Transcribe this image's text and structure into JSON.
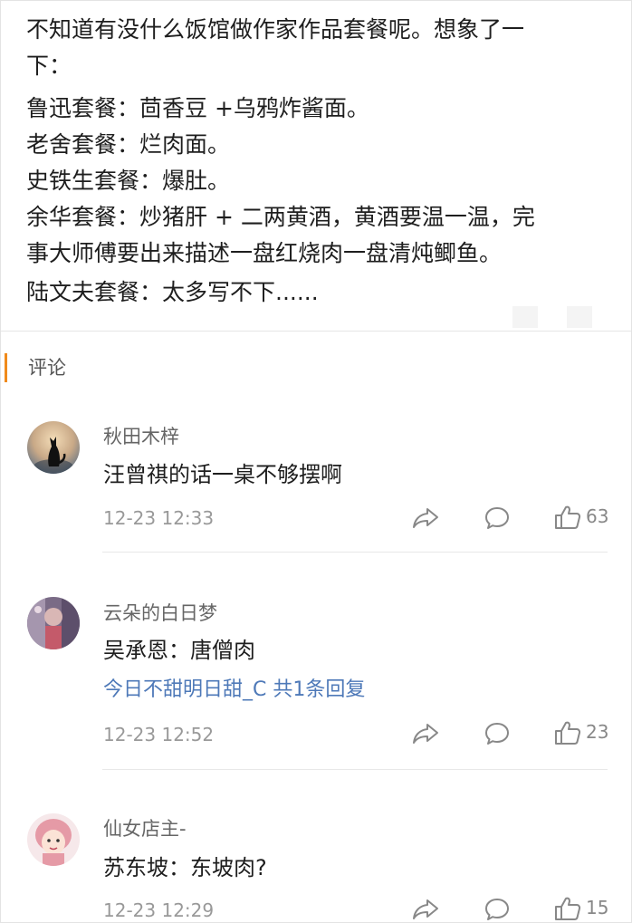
{
  "post": {
    "lines": [
      "不知道有没什么饭馆做作家作品套餐呢。想象了一",
      "下：",
      "鲁迅套餐：茴香豆 +乌鸦炸酱面。",
      "老舍套餐：烂肉面。",
      "史铁生套餐：爆肚。",
      "余华套餐：炒猪肝 + 二两黄酒，黄酒要温一温，完",
      "事大师傅要出来描述一盘红烧肉一盘清炖鲫鱼。",
      "陆文夫套餐：太多写不下......"
    ]
  },
  "comments_section": {
    "title": "评论",
    "accent_color": "#f08a1a"
  },
  "comments": [
    {
      "username": "秋田木梓",
      "text": "汪曾祺的话一桌不够摆啊",
      "time": "12-23 12:33",
      "likes": "63",
      "avatar_icon": "cat-silhouette-avatar"
    },
    {
      "username": "云朵的白日梦",
      "text": "吴承恩：唐僧肉",
      "reply_summary": "今日不甜明日甜_C  共1条回复",
      "time": "12-23 12:52",
      "likes": "23",
      "avatar_icon": "photo-avatar"
    },
    {
      "username": "仙女店主-",
      "text": "苏东坡：东坡肉?",
      "time": "12-23 12:29",
      "likes": "15",
      "avatar_icon": "cartoon-girl-avatar"
    }
  ],
  "icons": {
    "share": "share-arrow-icon",
    "reply": "comment-bubble-icon",
    "like": "thumbs-up-icon"
  },
  "colors": {
    "link": "#4e79b8",
    "meta": "#999999"
  }
}
